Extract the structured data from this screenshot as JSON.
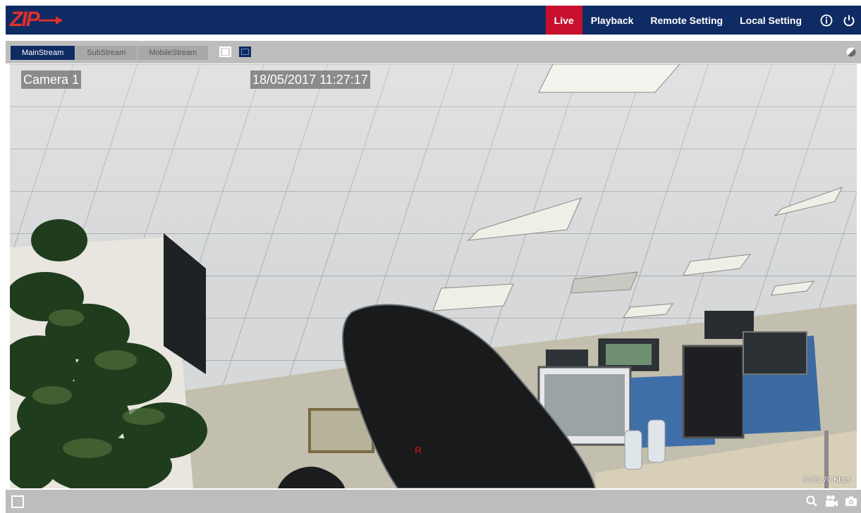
{
  "header": {
    "logo_text": "ZIP",
    "nav": [
      {
        "label": "Live",
        "active": true
      },
      {
        "label": "Playback",
        "active": false
      },
      {
        "label": "Remote Setting",
        "active": false
      },
      {
        "label": "Local Setting",
        "active": false
      }
    ],
    "icons": [
      "info-icon",
      "power-icon"
    ]
  },
  "toolbar": {
    "stream_tabs": [
      {
        "label": "MainStream",
        "active": true
      },
      {
        "label": "SubStream",
        "active": false
      },
      {
        "label": "MobileStream",
        "active": false
      }
    ],
    "layout_icons": [
      "single-view-icon",
      "quad-view-icon"
    ],
    "contrast_icon": "contrast-icon"
  },
  "video": {
    "camera_label": "Camera 1",
    "timestamp": "18/05/2017 11:27:17",
    "bitrate": "5785.70 Kbps",
    "record_mark": "R"
  },
  "bottombar": {
    "icons": [
      "fullscreen-icon",
      "zoom-icon",
      "record-icon",
      "snapshot-icon"
    ]
  },
  "colors": {
    "nav_bg": "#0f2b63",
    "active_tab": "#c8102e",
    "toolbar_bg": "#bdbdbd",
    "logo": "#e0302a"
  }
}
